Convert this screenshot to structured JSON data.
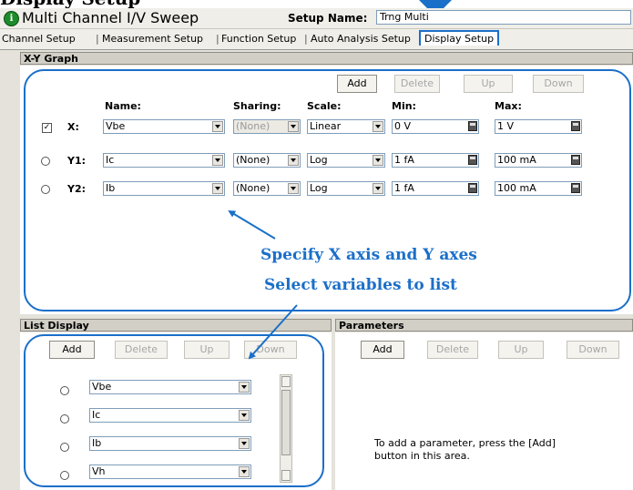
{
  "heading": "Display Setup",
  "window": {
    "title": "Multi Channel I/V Sweep",
    "setup_name_label": "Setup Name:",
    "setup_name_value": "Trng Multi"
  },
  "tabs": [
    {
      "label": "Channel Setup",
      "active": false
    },
    {
      "label": "Measurement Setup",
      "active": false
    },
    {
      "label": "Function Setup",
      "active": false
    },
    {
      "label": "Auto Analysis Setup",
      "active": false
    },
    {
      "label": "Display Setup",
      "active": true
    }
  ],
  "xy_graph": {
    "title": "X-Y Graph",
    "buttons": {
      "add": "Add",
      "delete": "Delete",
      "up": "Up",
      "down": "Down"
    },
    "columns": {
      "name": "Name:",
      "sharing": "Sharing:",
      "scale": "Scale:",
      "min": "Min:",
      "max": "Max:"
    },
    "rows": [
      {
        "label": "X:",
        "selector": "checkbox",
        "checked": true,
        "name": "Vbe",
        "sharing": "(None)",
        "sharing_disabled": true,
        "scale": "Linear",
        "min": "0 V",
        "max": "1 V"
      },
      {
        "label": "Y1:",
        "selector": "radio",
        "checked": false,
        "name": "Ic",
        "sharing": "(None)",
        "sharing_disabled": false,
        "scale": "Log",
        "min": "1 fA",
        "max": "100 mA"
      },
      {
        "label": "Y2:",
        "selector": "radio",
        "checked": false,
        "name": "Ib",
        "sharing": "(None)",
        "sharing_disabled": false,
        "scale": "Log",
        "min": "1 fA",
        "max": "100 mA"
      }
    ],
    "check_mark": "✓"
  },
  "annotations": {
    "axes": "Specify X axis and Y axes",
    "list": "Select variables to list"
  },
  "list_display": {
    "title": "List Display",
    "buttons": {
      "add": "Add",
      "delete": "Delete",
      "up": "Up",
      "down": "Down"
    },
    "items": [
      "Vbe",
      "Ic",
      "Ib",
      "Vh"
    ]
  },
  "parameters": {
    "title": "Parameters",
    "buttons": {
      "add": "Add",
      "delete": "Delete",
      "up": "Up",
      "down": "Down"
    },
    "hint_line1": "To add a parameter, press the [Add]",
    "hint_line2": "button in this area."
  },
  "colors": {
    "accent": "#1a6fc9",
    "panel": "#e4e2da",
    "header": "#d2d0c6"
  }
}
